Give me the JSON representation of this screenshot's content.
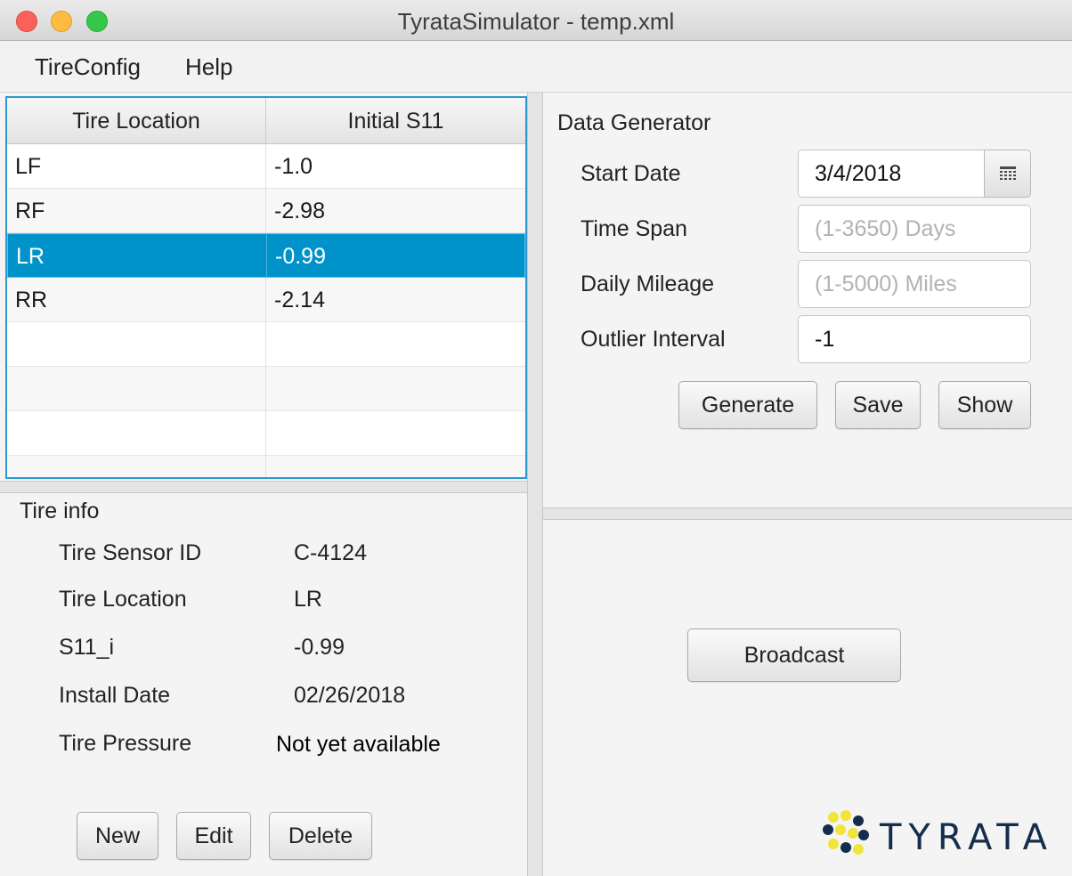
{
  "window": {
    "title": "TyrataSimulator - temp.xml"
  },
  "menu": {
    "items": [
      "TireConfig",
      "Help"
    ]
  },
  "table": {
    "columns": [
      "Tire Location",
      "Initial S11"
    ],
    "rows": [
      [
        "LF",
        "-1.0"
      ],
      [
        "RF",
        "-2.98"
      ],
      [
        "LR",
        "-0.99"
      ],
      [
        "RR",
        "-2.14"
      ]
    ],
    "selected_row": "LR"
  },
  "tire_info": {
    "title": "Tire info",
    "fields": [
      {
        "label": "Tire Sensor ID",
        "value": "C-4124"
      },
      {
        "label": "Tire Location",
        "value": "LR"
      },
      {
        "label": "S11_i",
        "value": "-0.99"
      },
      {
        "label": "Install Date",
        "value": "02/26/2018"
      },
      {
        "label": "Tire Pressure",
        "value": "Not yet available"
      }
    ],
    "buttons": [
      "New",
      "Edit",
      "Delete"
    ]
  },
  "data_generator": {
    "title": "Data Generator",
    "start_date": {
      "label": "Start Date",
      "value": "3/4/2018",
      "icon": "calendar-icon"
    },
    "time_span": {
      "label": "Time Span",
      "value": "",
      "placeholder": "(1-3650) Days"
    },
    "daily_mileage": {
      "label": "Daily Mileage",
      "value": "",
      "placeholder": "(1-5000) Miles"
    },
    "outlier_interval": {
      "label": "Outlier Interval",
      "value": "-1"
    },
    "buttons": [
      "Generate",
      "Save",
      "Show"
    ]
  },
  "broadcast": {
    "button": "Broadcast"
  },
  "logo": {
    "text": "TYRATA",
    "colors": {
      "yellow": "#f1e43a",
      "navy": "#142d4c"
    }
  },
  "colors": {
    "selection": "#0093c9",
    "table_border": "#2e98cf"
  }
}
